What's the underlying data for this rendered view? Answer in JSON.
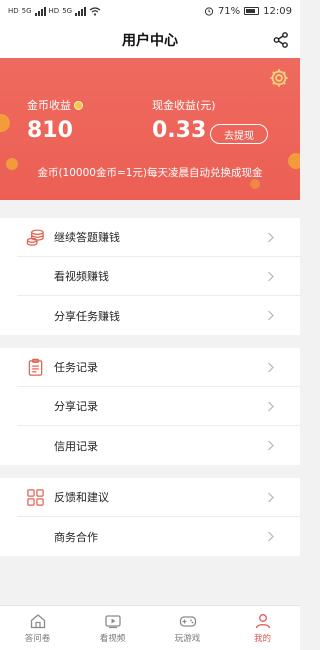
{
  "status_bar": {
    "left_labels": [
      "HD",
      "5G",
      "HD",
      "5G"
    ],
    "battery": "71%",
    "time": "12:09"
  },
  "nav": {
    "title": "用户中心"
  },
  "banner": {
    "gold_label": "金币收益",
    "gold_value": "810",
    "cash_label": "现金收益(元)",
    "cash_value": "0.33",
    "withdraw_label": "去提现",
    "note": "金币(10000金币=1元)每天凌晨自动兑换成现金"
  },
  "menu": {
    "group1": [
      "继续答题赚钱",
      "看视频赚钱",
      "分享任务赚钱"
    ],
    "group2": [
      "任务记录",
      "分享记录",
      "信用记录"
    ],
    "group3": [
      "反馈和建议",
      "商务合作"
    ]
  },
  "tabs": [
    {
      "label": "答问卷",
      "icon": "house-icon"
    },
    {
      "label": "看视频",
      "icon": "video-icon"
    },
    {
      "label": "玩游戏",
      "icon": "gamepad-icon"
    },
    {
      "label": "我的",
      "icon": "person-icon"
    }
  ],
  "colors": {
    "banner": "#ec5f55",
    "accent": "#e05a50",
    "coin": "#f2a23a"
  }
}
